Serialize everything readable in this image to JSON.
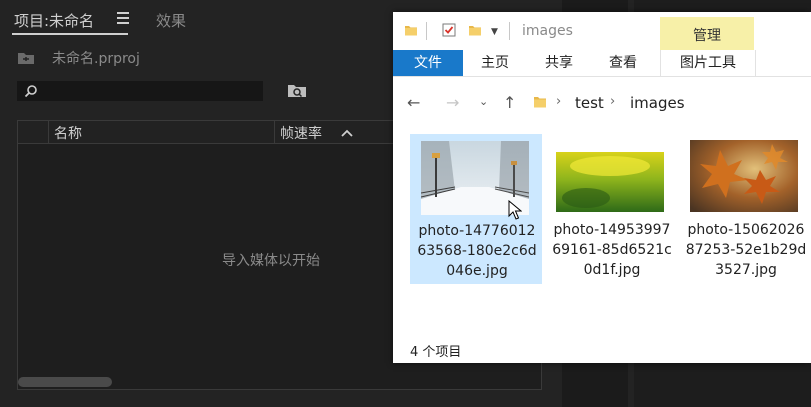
{
  "premiere": {
    "tabs": [
      {
        "label": "项目:未命名"
      },
      {
        "label": "效果"
      }
    ],
    "project_file": "未命名.prproj",
    "search": {
      "placeholder": ""
    },
    "columns": [
      {
        "label": "名称"
      },
      {
        "label": "帧速率"
      }
    ],
    "empty_message": "导入媒体以开始"
  },
  "explorer": {
    "title": "images",
    "context_tab_group": "管理",
    "ribbon_tabs": [
      {
        "label": "文件"
      },
      {
        "label": "主页"
      },
      {
        "label": "共享"
      },
      {
        "label": "查看"
      },
      {
        "label": "图片工具"
      }
    ],
    "breadcrumb": [
      {
        "label": "test"
      },
      {
        "label": "images"
      }
    ],
    "files": [
      {
        "name": "photo-1477601263568-180e2c6d046e.jpg",
        "selected": true,
        "thumb": "snowy-park-path"
      },
      {
        "name": "photo-1495399769161-85d6521c0d1f.jpg",
        "selected": false,
        "thumb": "green-yellow-meadow"
      },
      {
        "name": "photo-1506202687253-52e1b29d3527.jpg",
        "selected": false,
        "thumb": "autumn-maple-leaves"
      }
    ],
    "status": "4 个项目",
    "accent_color": "#1979ca"
  }
}
